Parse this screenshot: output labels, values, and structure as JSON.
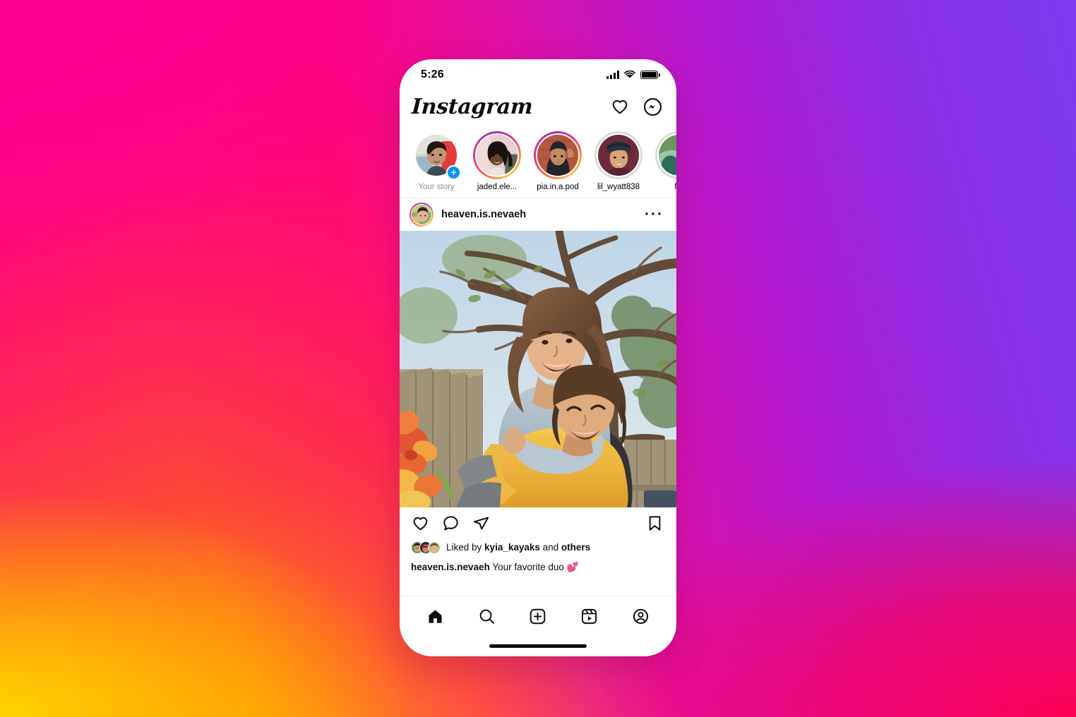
{
  "background": {
    "description": "Instagram brand gradient",
    "colors": {
      "top_left": "#ff0091",
      "top_right": "#7b3af0",
      "bottom_left": "#ffd200",
      "bottom_right": "#ff0055",
      "mid_left": "#fd4a34"
    }
  },
  "status_bar": {
    "time": "5:26",
    "signal_icon": "cellular-signal-icon",
    "wifi_icon": "wifi-icon",
    "battery_icon": "battery-full-icon",
    "battery_level": 100
  },
  "app_header": {
    "wordmark": "Instagram",
    "actions": [
      {
        "name": "activity-heart-icon",
        "label": "Activity"
      },
      {
        "name": "messenger-icon",
        "label": "Messages"
      }
    ]
  },
  "stories": [
    {
      "label": "Your story",
      "ring": "own",
      "muted": true,
      "has_add_badge": true,
      "badge": "+"
    },
    {
      "label": "jaded.ele...",
      "ring": "active",
      "muted": false,
      "has_add_badge": false,
      "badge": ""
    },
    {
      "label": "pia.in.a.pod",
      "ring": "active",
      "muted": false,
      "has_add_badge": false,
      "badge": ""
    },
    {
      "label": "lil_wyatt838",
      "ring": "seen",
      "muted": false,
      "has_add_badge": false,
      "badge": ""
    },
    {
      "label": "fre",
      "ring": "seen",
      "muted": false,
      "has_add_badge": false,
      "badge": ""
    }
  ],
  "post": {
    "username": "heaven.is.nevaeh",
    "avatar_name": "post-author-avatar",
    "more_options": "···",
    "photo_alt": "Two friends laughing outdoors, one giving the other a piggyback ride in front of a tree and a wooden fence with a painted flower mural",
    "actions": [
      {
        "name": "like-heart-icon",
        "label": "Like"
      },
      {
        "name": "comment-bubble-icon",
        "label": "Comment"
      },
      {
        "name": "share-paperplane-icon",
        "label": "Share"
      },
      {
        "name": "save-bookmark-icon",
        "label": "Save"
      }
    ],
    "likes_prefix": "Liked by ",
    "likes_user": "kyia_kayaks",
    "likes_middle": " and ",
    "likes_suffix": "others",
    "caption_user": "heaven.is.nevaeh",
    "caption_text": " Your favorite duo 💕"
  },
  "tab_bar": [
    {
      "name": "tab-home",
      "label": "Home",
      "icon": "home-icon",
      "active": true
    },
    {
      "name": "tab-search",
      "label": "Search",
      "icon": "search-icon",
      "active": false
    },
    {
      "name": "tab-create",
      "label": "Create",
      "icon": "plus-box-icon",
      "active": false
    },
    {
      "name": "tab-reels",
      "label": "Reels",
      "icon": "reels-icon",
      "active": false
    },
    {
      "name": "tab-profile",
      "label": "Profile",
      "icon": "profile-icon",
      "active": false
    }
  ]
}
